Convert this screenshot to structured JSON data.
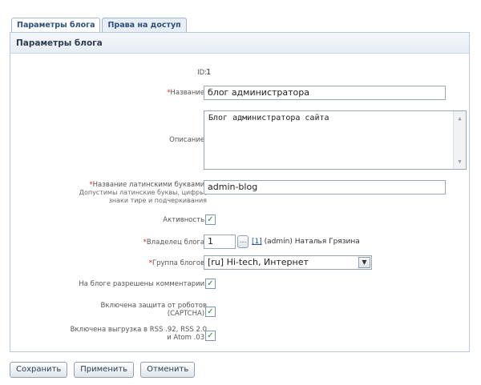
{
  "tabs": [
    {
      "label": "Параметры блога",
      "active": true
    },
    {
      "label": "Права на доступ",
      "active": false
    }
  ],
  "panel_title": "Параметры блога",
  "fields": {
    "id": {
      "label": "ID:",
      "value": "1"
    },
    "name": {
      "label": "Название:",
      "value": "блог администратора"
    },
    "description": {
      "label": "Описание:",
      "value": "Блог администратора сайта"
    },
    "latin_name": {
      "label": "Название латинскими буквами:",
      "hint_1": "Допустимы латинские буквы, цифры,",
      "hint_2": "знаки тире и подчеркивания",
      "value": "admin-blog"
    },
    "active": {
      "label": "Активность:",
      "checked": true
    },
    "owner": {
      "label": "Владелец блога:",
      "value": "1",
      "link": "[1]",
      "name": "(admin) Наталья Грязина"
    },
    "group": {
      "label": "Группа блогов:",
      "value": "[ru] Hi-tech, Интернет"
    },
    "comments": {
      "label": "На блоге разрешены комментарии:",
      "checked": true
    },
    "captcha": {
      "label_1": "Включена защита от роботов",
      "label_2": "(CAPTCHA):",
      "checked": true
    },
    "rss": {
      "label_1": "Включена выгрузка в RSS .92, RSS 2.0",
      "label_2": "и Atom .03:",
      "checked": true
    }
  },
  "buttons": {
    "save": "Сохранить",
    "apply": "Применить",
    "cancel": "Отменить"
  },
  "required_mark": "*",
  "colors": {
    "required": "#e0262b",
    "accent": "#2c4f7c",
    "link": "#2255aa"
  }
}
